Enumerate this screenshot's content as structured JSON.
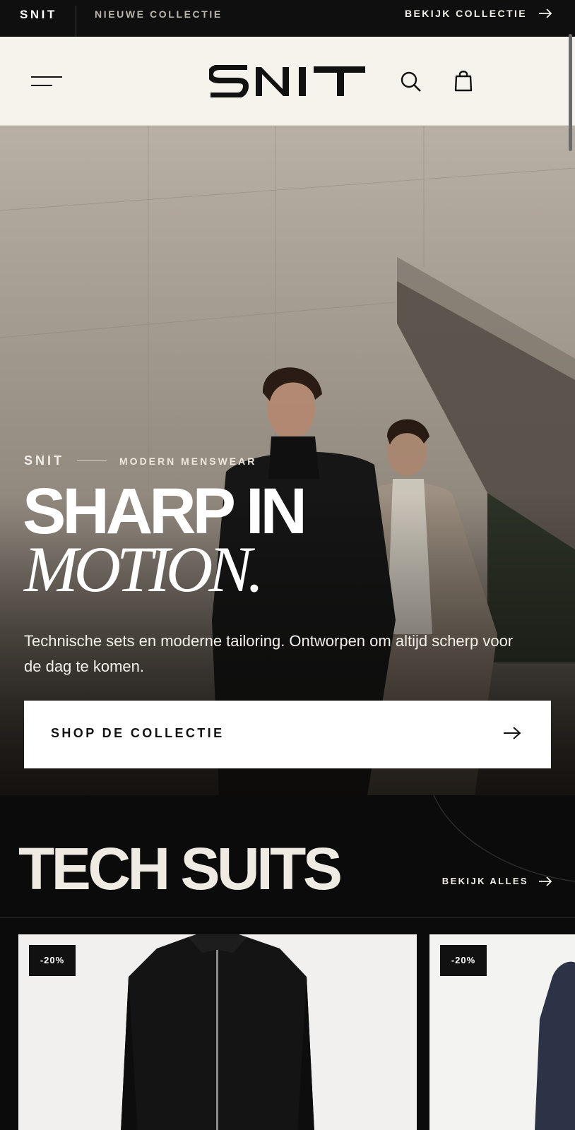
{
  "topbar": {
    "brand": "SNIT",
    "announcement": "NIEUWE COLLECTIE",
    "view_collection": "BEKIJK COLLECTIE"
  },
  "header": {
    "logo_text": "SNIT",
    "icons": [
      "menu-icon",
      "search-icon",
      "shopping-bag-icon"
    ]
  },
  "hero": {
    "eyebrow_brand": "SNIT",
    "eyebrow_tagline": "MODERN MENSWEAR",
    "headline_line1": "SHARP IN",
    "headline_line2": "MOTION.",
    "description": "Technische sets en moderne tailoring. Ontworpen om altijd scherp voor de dag te komen.",
    "cta_label": "SHOP DE COLLECTIE"
  },
  "section": {
    "title": "TECH SUITS",
    "view_all": "BEKIJK ALLES",
    "products": [
      {
        "badge": "-20%"
      },
      {
        "badge": "-20%"
      }
    ]
  },
  "colors": {
    "bar_dark": "#0f0f0f",
    "header_bg": "#f6f3ec",
    "section_bg": "#0b0b0b",
    "accent_text": "#efebe3"
  }
}
